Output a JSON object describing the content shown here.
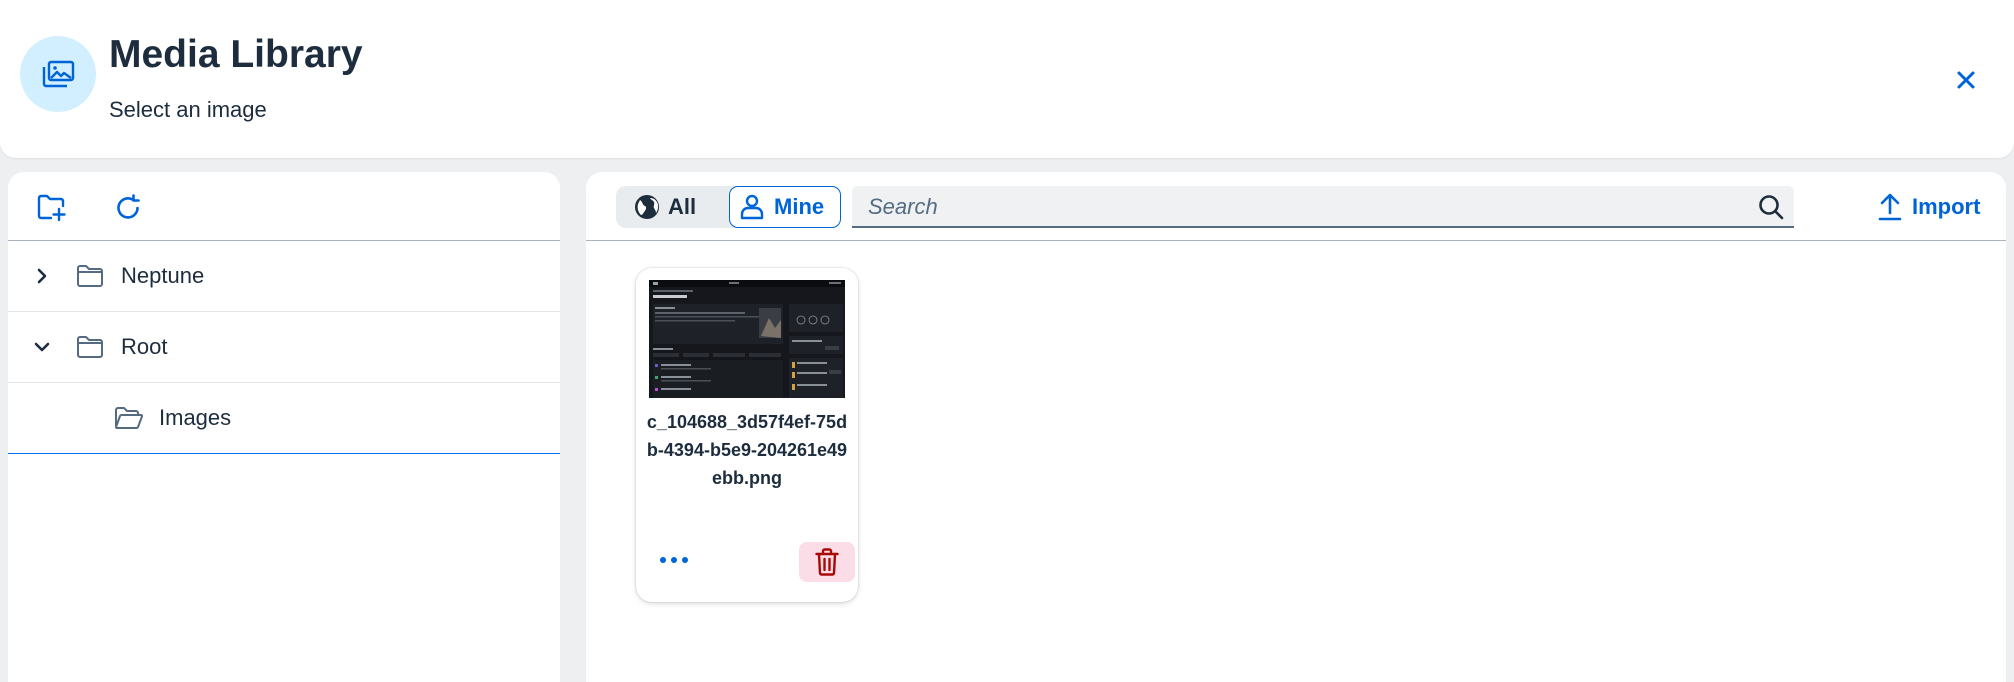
{
  "header": {
    "title": "Media Library",
    "subtitle": "Select an image",
    "icon": "media-library-icon",
    "close_icon": "close-icon"
  },
  "left_toolbar": {
    "new_folder_icon": "add-folder-icon",
    "refresh_icon": "refresh-icon"
  },
  "tree": {
    "items": [
      {
        "label": "Neptune",
        "expanded": false,
        "level": 0
      },
      {
        "label": "Root",
        "expanded": true,
        "level": 0
      },
      {
        "label": "Images",
        "level": 1,
        "selected": true
      }
    ]
  },
  "filter": {
    "all_label": "All",
    "mine_label": "Mine",
    "selected": "Mine"
  },
  "search": {
    "placeholder": "Search",
    "value": ""
  },
  "import": {
    "label": "Import"
  },
  "files": [
    {
      "name": "c_104688_3d57f4ef-75db-4394-b5e9-204261e49ebb.png"
    }
  ],
  "colors": {
    "accent": "#0064d9",
    "header_icon_bg": "#d1efff",
    "delete_bg": "#fadde7",
    "delete_icon": "#aa0808",
    "text": "#1d2d3e"
  }
}
